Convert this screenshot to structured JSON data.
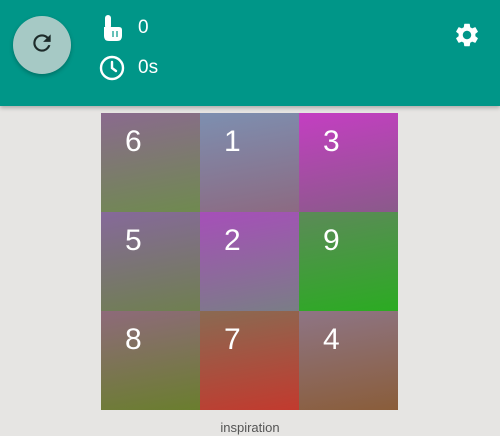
{
  "header": {
    "moves_value": "0",
    "time_value": "0s",
    "colors": {
      "appbar": "#009688",
      "refresh_button": "#a6c9c5"
    },
    "icons": {
      "refresh": "refresh-icon",
      "moves": "touch-icon",
      "time": "clock-icon",
      "settings": "gear-icon"
    }
  },
  "board": {
    "tiles": [
      {
        "label": "6",
        "colors": [
          "#8a6a8e",
          "#6f8a4f"
        ]
      },
      {
        "label": "1",
        "colors": [
          "#7d8fb0",
          "#8c6a82"
        ]
      },
      {
        "label": "3",
        "colors": [
          "#c43ec2",
          "#8a5a8a"
        ]
      },
      {
        "label": "5",
        "colors": [
          "#86699a",
          "#6f7f50"
        ]
      },
      {
        "label": "2",
        "colors": [
          "#a64fb9",
          "#7a7d86"
        ]
      },
      {
        "label": "9",
        "colors": [
          "#5c8a58",
          "#2bab22"
        ]
      },
      {
        "label": "8",
        "colors": [
          "#8e6a7a",
          "#6a7e2e"
        ]
      },
      {
        "label": "7",
        "colors": [
          "#8a6a52",
          "#c23a2e"
        ]
      },
      {
        "label": "4",
        "colors": [
          "#8e7585",
          "#8a5d3a"
        ]
      }
    ]
  },
  "footer": {
    "caption": "inspiration"
  }
}
